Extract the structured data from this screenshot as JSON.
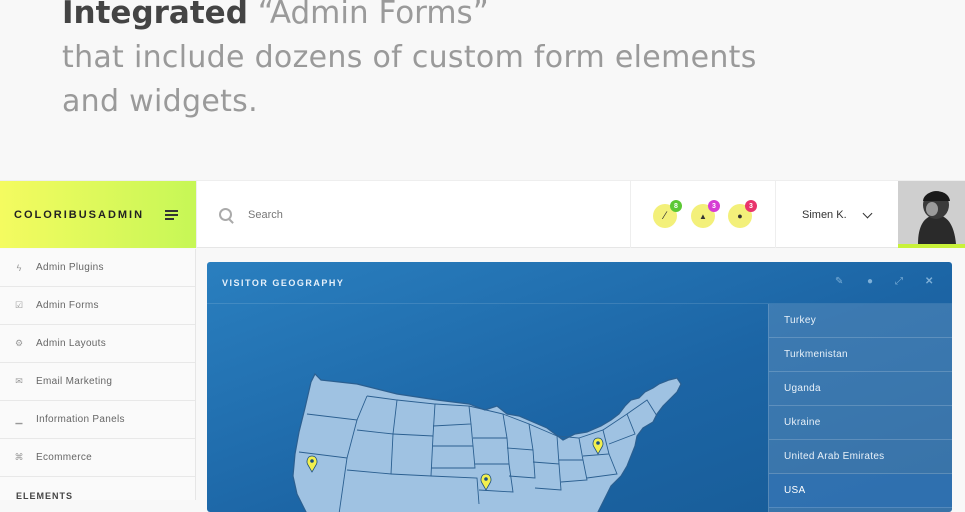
{
  "hero": {
    "bold": "Integrated",
    "quoted": "“Admin Forms”",
    "subtitle_line1": "that include dozens of custom form elements",
    "subtitle_line2": "and widgets."
  },
  "topbar": {
    "brand": "COLORIBUSADMIN",
    "search_placeholder": "Search",
    "notifications": [
      {
        "icon": "wand-icon",
        "glyph": "∕",
        "count": "8",
        "badge_color": "#5cc834"
      },
      {
        "icon": "bell-icon",
        "glyph": "▲",
        "count": "3",
        "badge_color": "#d63dd4"
      },
      {
        "icon": "chat-icon",
        "glyph": "●",
        "count": "3",
        "badge_color": "#e8346c"
      }
    ],
    "user_name": "Simen K."
  },
  "sidebar": {
    "items": [
      {
        "label": "Admin Plugins",
        "icon": "bolt-icon",
        "glyph": "ϟ"
      },
      {
        "label": "Admin Forms",
        "icon": "checkbox-icon",
        "glyph": "☑"
      },
      {
        "label": "Admin Layouts",
        "icon": "gear-icon",
        "glyph": "⚙"
      },
      {
        "label": "Email Marketing",
        "icon": "envelope-icon",
        "glyph": "✉"
      },
      {
        "label": "Information Panels",
        "icon": "signal-icon",
        "glyph": "▁"
      },
      {
        "label": "Ecommerce",
        "icon": "cart-icon",
        "glyph": "⌘"
      }
    ],
    "section_label": "ELEMENTS"
  },
  "panel": {
    "title": "VISITOR GEOGRAPHY",
    "countries": [
      "Turkey",
      "Turkmenistan",
      "Uganda",
      "Ukraine",
      "United Arab Emirates",
      "USA"
    ],
    "active_country": "USA"
  }
}
